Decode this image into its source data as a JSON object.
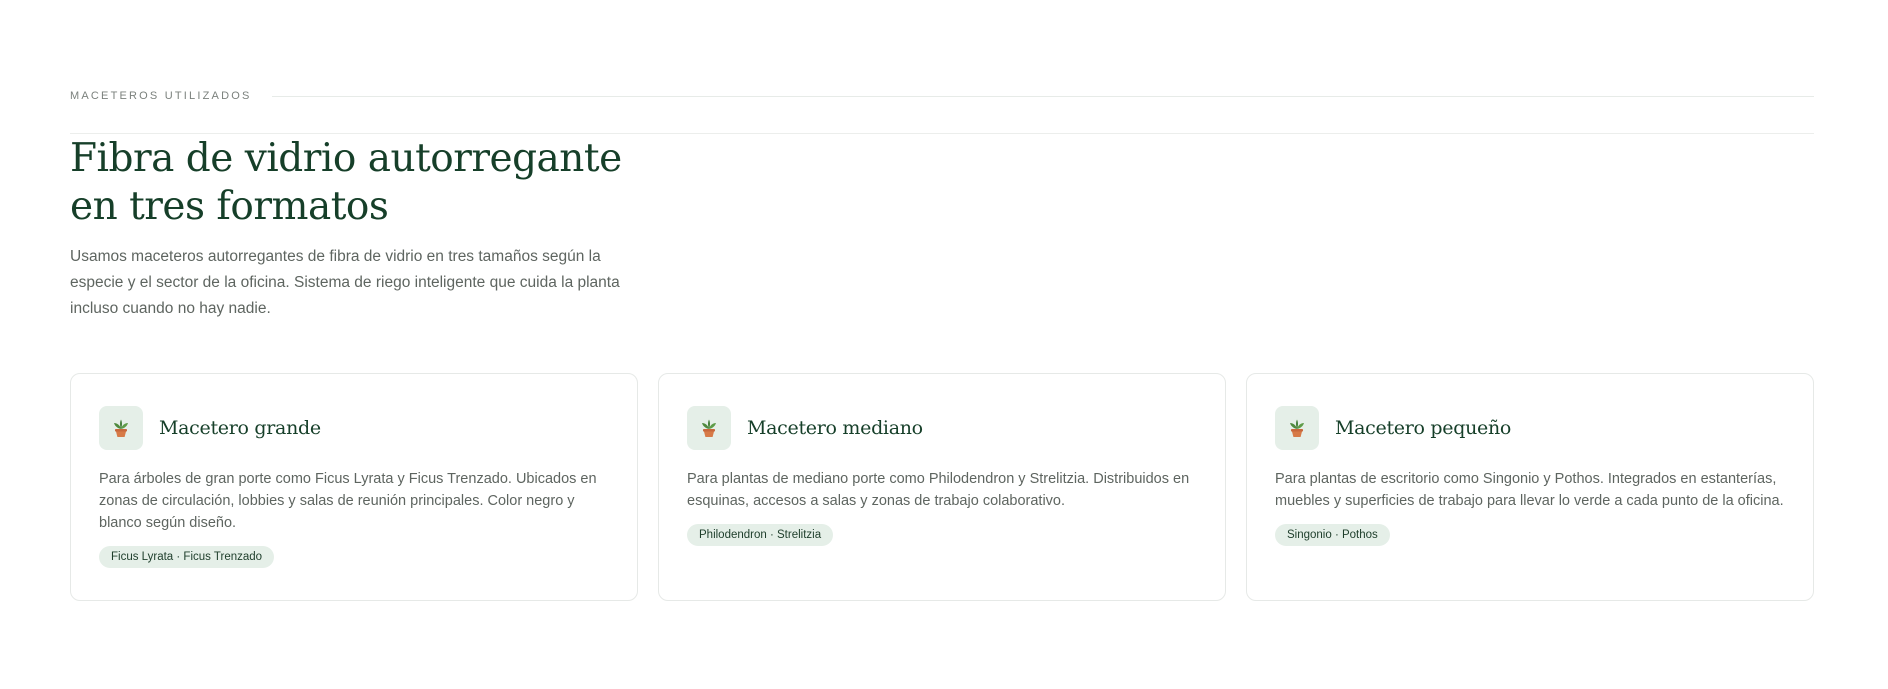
{
  "section": {
    "eyebrow": "MACETEROS UTILIZADOS",
    "headline_line1": "Fibra de vidrio autorregante",
    "headline_line2": "en tres formatos",
    "intro": "Usamos maceteros autorregantes de fibra de vidrio en tres tamaños según la especie y el sector de la oficina. Sistema de riego inteligente que cuida la planta incluso cuando no hay nadie."
  },
  "cards": [
    {
      "icon": "potted-plant-icon",
      "title": "Macetero grande",
      "description": "Para árboles de gran porte como Ficus Lyrata y Ficus Trenzado. Ubicados en zonas de circulación, lobbies y salas de reunión principales. Color negro y blanco según diseño.",
      "tag": "Ficus Lyrata · Ficus Trenzado"
    },
    {
      "icon": "potted-plant-icon",
      "title": "Macetero mediano",
      "description": "Para plantas de mediano porte como Philodendron y Strelitzia. Distribuidos en esquinas, accesos a salas y zonas de trabajo colaborativo.",
      "tag": "Philodendron · Strelitzia"
    },
    {
      "icon": "potted-plant-icon",
      "title": "Macetero pequeño",
      "description": "Para plantas de escritorio como Singonio y Pothos. Integrados en estanterías, muebles y superficies de trabajo para llevar lo verde a cada punto de la oficina.",
      "tag": "Singonio · Pothos"
    }
  ],
  "colors": {
    "accent": "#163f29",
    "tag_bg": "#e5efe8",
    "text": "#5e6560",
    "border": "#e6e9e7"
  }
}
